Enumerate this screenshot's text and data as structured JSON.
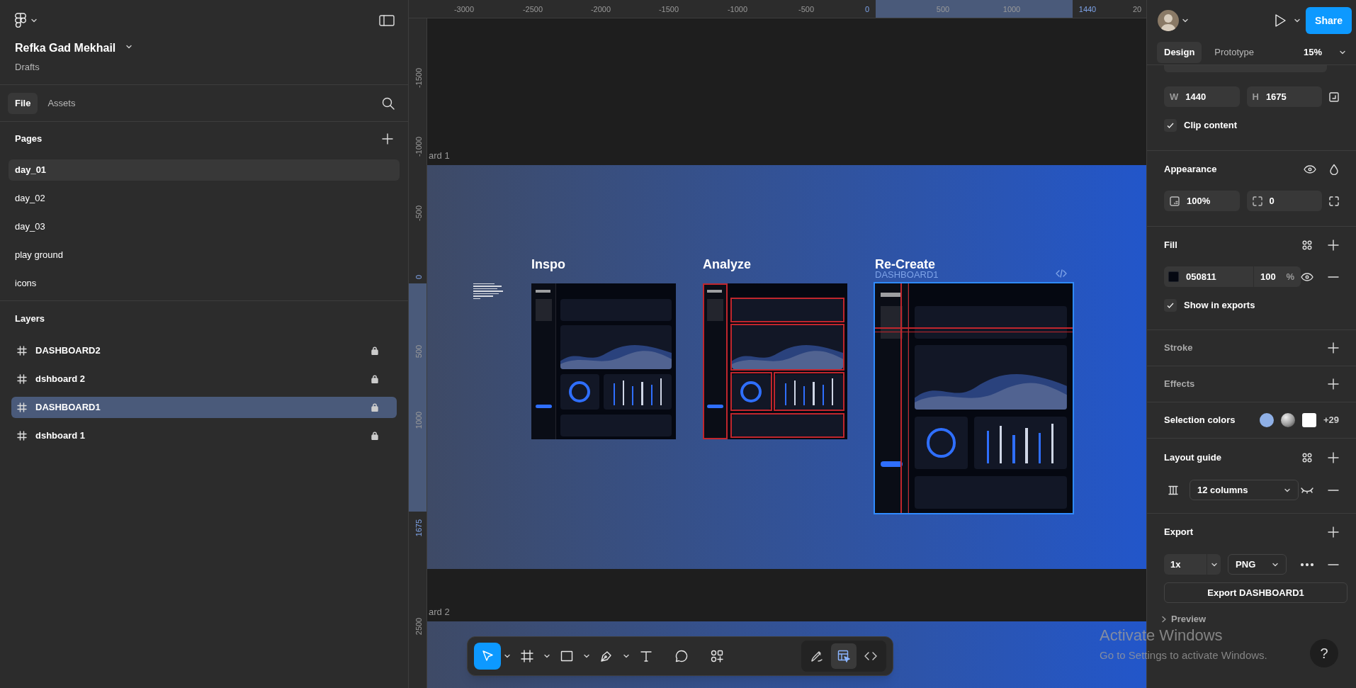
{
  "left_panel": {
    "project_name": "Refka Gad Mekhail",
    "location": "Drafts",
    "tabs": [
      {
        "label": "File",
        "selected": true
      },
      {
        "label": "Assets",
        "selected": false
      }
    ],
    "pages_title": "Pages",
    "pages": [
      {
        "label": "day_01",
        "selected": true
      },
      {
        "label": "day_02",
        "selected": false
      },
      {
        "label": "day_03",
        "selected": false
      },
      {
        "label": "play ground",
        "selected": false
      },
      {
        "label": "icons",
        "selected": false
      }
    ],
    "layers_title": "Layers",
    "layers": [
      {
        "name": "DASHBOARD2",
        "selected": false,
        "locked": true
      },
      {
        "name": "dshboard 2",
        "selected": false,
        "locked": true
      },
      {
        "name": "DASHBOARD1",
        "selected": true,
        "locked": true
      },
      {
        "name": "dshboard 1",
        "selected": false,
        "locked": true
      }
    ]
  },
  "rulers": {
    "horizontal": [
      {
        "label": "-3000",
        "highlighted": false
      },
      {
        "label": "-2500",
        "highlighted": false
      },
      {
        "label": "-2000",
        "highlighted": false
      },
      {
        "label": "-1500",
        "highlighted": false
      },
      {
        "label": "-1000",
        "highlighted": false
      },
      {
        "label": "-500",
        "highlighted": false
      },
      {
        "label": "0",
        "highlighted": true
      },
      {
        "label": "500",
        "highlighted": false
      },
      {
        "label": "1000",
        "highlighted": false
      },
      {
        "label": "1440",
        "highlighted": true
      },
      {
        "label": "20",
        "highlighted": false
      }
    ],
    "vertical": [
      {
        "label": "-1500",
        "highlighted": false
      },
      {
        "label": "-1000",
        "highlighted": false
      },
      {
        "label": "-500",
        "highlighted": false
      },
      {
        "label": "0",
        "highlighted": true
      },
      {
        "label": "500",
        "highlighted": false
      },
      {
        "label": "1000",
        "highlighted": false
      },
      {
        "label": "1675",
        "highlighted": true
      },
      {
        "label": "2500",
        "highlighted": false
      }
    ]
  },
  "canvas": {
    "frame_labels": [
      "ard 1",
      "ard 2"
    ],
    "boards": [
      {
        "title": "Inspo",
        "kind": "plain",
        "selected": false
      },
      {
        "title": "Analyze",
        "kind": "annotated",
        "selected": false
      },
      {
        "title": "Re-Create",
        "subtitle": "DASHBOARD1",
        "kind": "guided",
        "selected": true
      }
    ]
  },
  "toolbar": {
    "tools": [
      {
        "kind": "move",
        "selected": true
      },
      {
        "kind": "frame",
        "selected": false
      },
      {
        "kind": "shape",
        "selected": false
      },
      {
        "kind": "pen",
        "selected": false
      },
      {
        "kind": "text",
        "selected": false
      },
      {
        "kind": "comment",
        "selected": false
      },
      {
        "kind": "actions",
        "selected": false
      }
    ],
    "modes": [
      {
        "kind": "draw",
        "selected": false
      },
      {
        "kind": "design",
        "selected": true
      },
      {
        "kind": "dev",
        "selected": false
      }
    ]
  },
  "right_panel": {
    "share": "Share",
    "tabs": [
      {
        "label": "Design",
        "selected": true
      },
      {
        "label": "Prototype",
        "selected": false
      }
    ],
    "zoom": "15%",
    "width": {
      "label": "W",
      "value": "1440"
    },
    "height": {
      "label": "H",
      "value": "1675"
    },
    "clip_content": {
      "label": "Clip content",
      "checked": true
    },
    "appearance": {
      "title": "Appearance",
      "opacity": "100%",
      "corner_radius": "0"
    },
    "fill": {
      "title": "Fill",
      "hex": "050811",
      "opacity": "100",
      "unit": "%",
      "show_in_exports": {
        "label": "Show in exports",
        "checked": true
      }
    },
    "stroke": {
      "title": "Stroke"
    },
    "effects": {
      "title": "Effects"
    },
    "selection_colors": {
      "title": "Selection colors",
      "swatches": [
        {
          "kind": "solid",
          "color": "#8fb0e6"
        },
        {
          "kind": "gradient",
          "color": "#9a9a9a"
        },
        {
          "kind": "solid",
          "color": "#ffffff"
        }
      ],
      "more": "+29"
    },
    "layout_guide": {
      "title": "Layout guide",
      "value": "12 columns"
    },
    "export": {
      "title": "Export",
      "scale": "1x",
      "format": "PNG",
      "button": "Export DASHBOARD1"
    },
    "preview": "Preview",
    "help": "?"
  },
  "os_notice": {
    "title": "Activate Windows",
    "message": "Go to Settings to activate Windows."
  }
}
